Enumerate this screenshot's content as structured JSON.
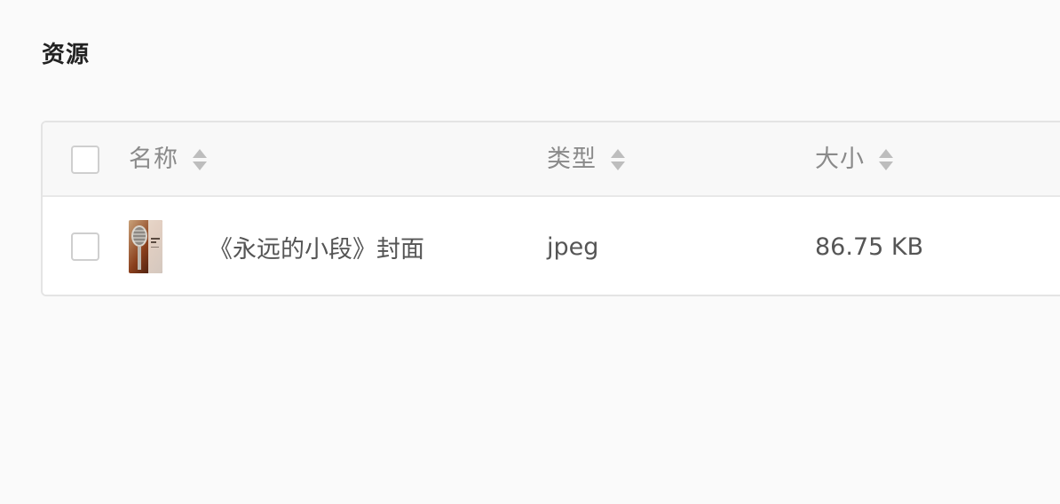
{
  "page": {
    "title": "资源"
  },
  "table": {
    "columns": [
      {
        "label": "名称"
      },
      {
        "label": "类型"
      },
      {
        "label": "大小"
      }
    ],
    "rows": [
      {
        "name": "《永远的小段》封面",
        "type": "jpeg",
        "size": "86.75 KB",
        "thumbnail_icon": "microphone-cover-image"
      }
    ]
  },
  "colors": {
    "background": "#fafafa",
    "header_bg": "#f8f8f8",
    "border": "#e4e4e4",
    "header_text": "#8a8a8a",
    "body_text": "#555555"
  }
}
